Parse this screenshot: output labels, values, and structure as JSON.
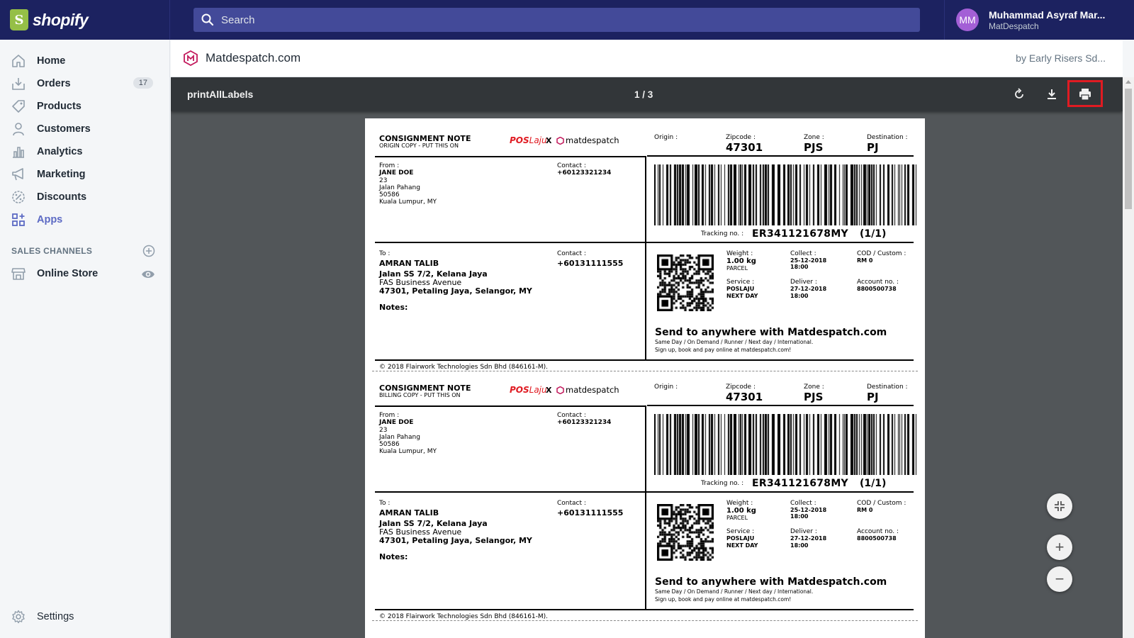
{
  "topbar": {
    "brand": "shopify",
    "search_placeholder": "Search",
    "user_initials": "MM",
    "user_name": "Muhammad Asyraf Mar...",
    "user_store": "MatDespatch"
  },
  "sidebar": {
    "items": [
      {
        "label": "Home",
        "icon": "home-icon"
      },
      {
        "label": "Orders",
        "icon": "orders-icon",
        "badge": "17"
      },
      {
        "label": "Products",
        "icon": "tag-icon"
      },
      {
        "label": "Customers",
        "icon": "person-icon"
      },
      {
        "label": "Analytics",
        "icon": "bar-chart-icon"
      },
      {
        "label": "Marketing",
        "icon": "megaphone-icon"
      },
      {
        "label": "Discounts",
        "icon": "discount-icon"
      },
      {
        "label": "Apps",
        "icon": "apps-icon",
        "active": true
      }
    ],
    "sales_channels_heading": "SALES CHANNELS",
    "online_store": "Online Store",
    "settings": "Settings"
  },
  "app": {
    "title": "Matdespatch.com",
    "by": "by Early Risers Sd..."
  },
  "viewer": {
    "file_name": "printAllLabels",
    "page_indicator": "1 / 3",
    "zoom_in": "+",
    "zoom_out": "−"
  },
  "labels": [
    {
      "title": "CONSIGNMENT NOTE",
      "subtitle": "ORIGIN COPY - PUT THIS ON",
      "brand_pos": "POS",
      "brand_laju": "Laju",
      "brand_x": "X",
      "brand_matdespatch": "matdespatch",
      "origin_label": "Origin :",
      "zipcode_label": "Zipcode :",
      "zipcode": "47301",
      "zone_label": "Zone :",
      "zone": "PJS",
      "destination_label": "Destination :",
      "destination": "PJ",
      "from_label": "From :",
      "from_name": "JANE DOE",
      "from_lines": [
        "23",
        "Jalan Pahang",
        "50586",
        "Kuala Lumpur, MY"
      ],
      "contact_label": "Contact :",
      "from_contact": "+60123321234",
      "tracking_label": "Tracking no. :",
      "tracking": "ER341121678MY",
      "pieces": "(1/1)",
      "to_label": "To :",
      "to_name": "AMRAN TALIB",
      "to_line1": "Jalan SS 7/2, Kelana Jaya",
      "to_line2": "FAS Business Avenue",
      "to_line3": "47301, Petaling Jaya, Selangor, MY",
      "to_contact": "+60131111555",
      "notes_label": "Notes:",
      "weight_label": "Weight :",
      "weight": "1.00 kg",
      "weight_type": "PARCEL",
      "collect_label": "Collect :",
      "collect_date": "25-12-2018",
      "collect_time": "18:00",
      "cod_label": "COD / Custom :",
      "cod": "RM 0",
      "service_label": "Service :",
      "service1": "POSLAJU",
      "service2": "NEXT DAY",
      "deliver_label": "Deliver :",
      "deliver_date": "27-12-2018",
      "deliver_time": "18:00",
      "account_label": "Account no. :",
      "account": "8800500738",
      "promo_title": "Send to anywhere with Matdespatch.com",
      "promo_line1": "Same Day / On Demand / Runner / Next day / International.",
      "promo_line2": "Sign up, book and pay online at matdespatch.com!",
      "copyright": "© 2018 Flairwork Technologies Sdn Bhd (846161-M)."
    },
    {
      "title": "CONSIGNMENT NOTE",
      "subtitle": "BILLING COPY - PUT THIS ON",
      "brand_pos": "POS",
      "brand_laju": "Laju",
      "brand_x": "X",
      "brand_matdespatch": "matdespatch",
      "origin_label": "Origin :",
      "zipcode_label": "Zipcode :",
      "zipcode": "47301",
      "zone_label": "Zone :",
      "zone": "PJS",
      "destination_label": "Destination :",
      "destination": "PJ",
      "from_label": "From :",
      "from_name": "JANE DOE",
      "from_lines": [
        "23",
        "Jalan Pahang",
        "50586",
        "Kuala Lumpur, MY"
      ],
      "contact_label": "Contact :",
      "from_contact": "+60123321234",
      "tracking_label": "Tracking no. :",
      "tracking": "ER341121678MY",
      "pieces": "(1/1)",
      "to_label": "To :",
      "to_name": "AMRAN TALIB",
      "to_line1": "Jalan SS 7/2, Kelana Jaya",
      "to_line2": "FAS Business Avenue",
      "to_line3": "47301, Petaling Jaya, Selangor, MY",
      "to_contact": "+60131111555",
      "notes_label": "Notes:",
      "weight_label": "Weight :",
      "weight": "1.00 kg",
      "weight_type": "PARCEL",
      "collect_label": "Collect :",
      "collect_date": "25-12-2018",
      "collect_time": "18:00",
      "cod_label": "COD / Custom :",
      "cod": "RM 0",
      "service_label": "Service :",
      "service1": "POSLAJU",
      "service2": "NEXT DAY",
      "deliver_label": "Deliver :",
      "deliver_date": "27-12-2018",
      "deliver_time": "18:00",
      "account_label": "Account no. :",
      "account": "8800500738",
      "promo_title": "Send to anywhere with Matdespatch.com",
      "promo_line1": "Same Day / On Demand / Runner / Next day / International.",
      "promo_line2": "Sign up, book and pay online at matdespatch.com!",
      "copyright": "© 2018 Flairwork Technologies Sdn Bhd (846161-M)."
    }
  ],
  "colors": {
    "topbar": "#1c2260",
    "search": "#434a99",
    "active_nav": "#5c6ac4",
    "viewer_bg": "#525659",
    "viewer_toolbar": "#323639",
    "highlight": "#e01b22",
    "poslaju_red": "#e01b22"
  }
}
